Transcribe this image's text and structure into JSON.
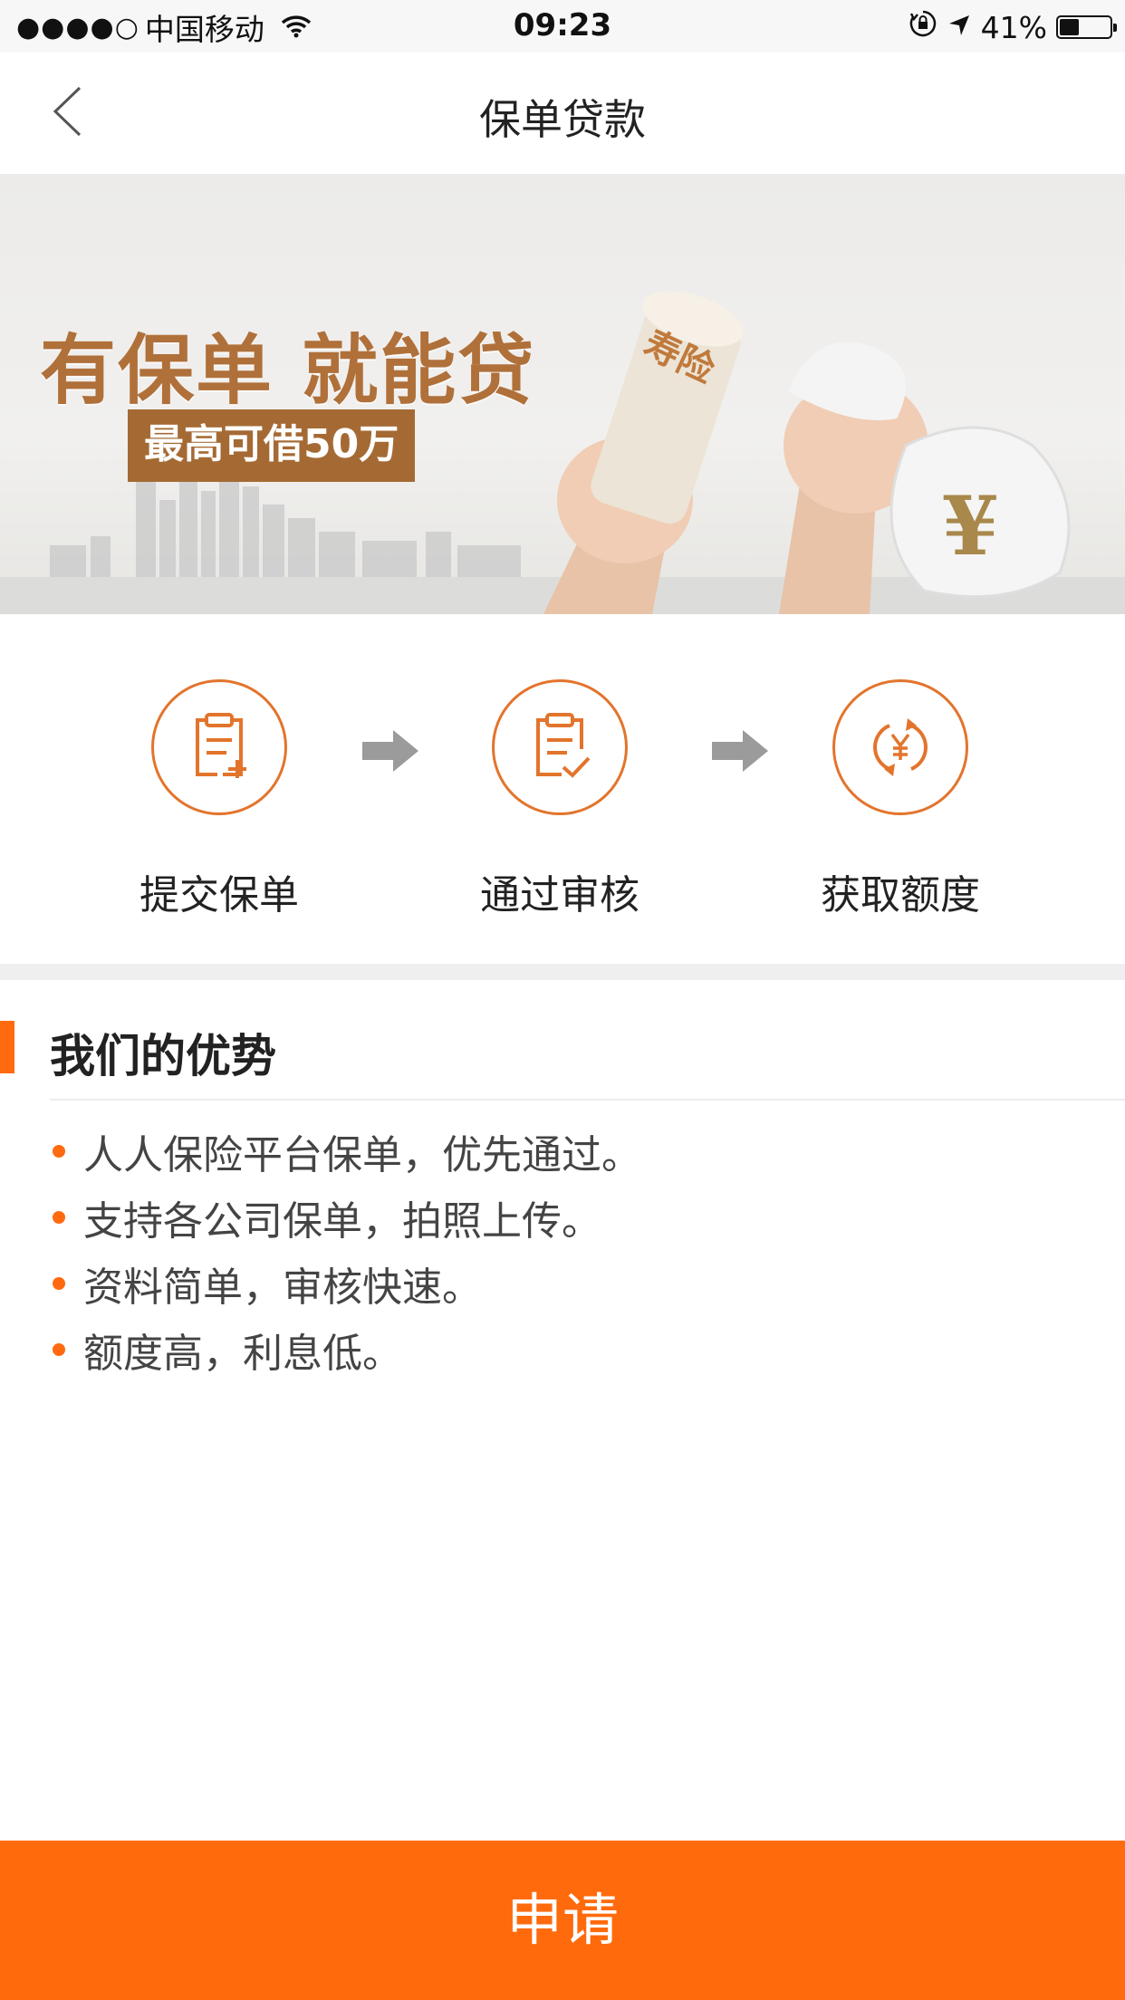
{
  "status_bar": {
    "signal": "●●●●○",
    "carrier": "中国移动",
    "time": "09:23",
    "battery": "41%",
    "battery_level": 0.41
  },
  "nav": {
    "title": "保单贷款",
    "back_icon": "chevron-left-icon"
  },
  "banner": {
    "slogan": "有保单 就能贷",
    "sub_slogan": "最高可借50万",
    "scroll_label": "寿险",
    "bag_symbol": "¥"
  },
  "steps": [
    {
      "label": "提交保单",
      "icon": "clipboard-add-icon"
    },
    {
      "label": "通过审核",
      "icon": "clipboard-check-icon"
    },
    {
      "label": "获取额度",
      "icon": "yuan-cycle-icon"
    }
  ],
  "advantages": {
    "title": "我们的优势",
    "items": [
      "人人保险平台保单，优先通过。",
      "支持各公司保单，拍照上传。",
      "资料简单，审核快速。",
      "额度高，利息低。"
    ]
  },
  "apply_button": {
    "label": "申请"
  },
  "colors": {
    "accent": "#ff6a0c",
    "icon_orange": "#e3742c",
    "banner_brown": "#b0703a"
  }
}
